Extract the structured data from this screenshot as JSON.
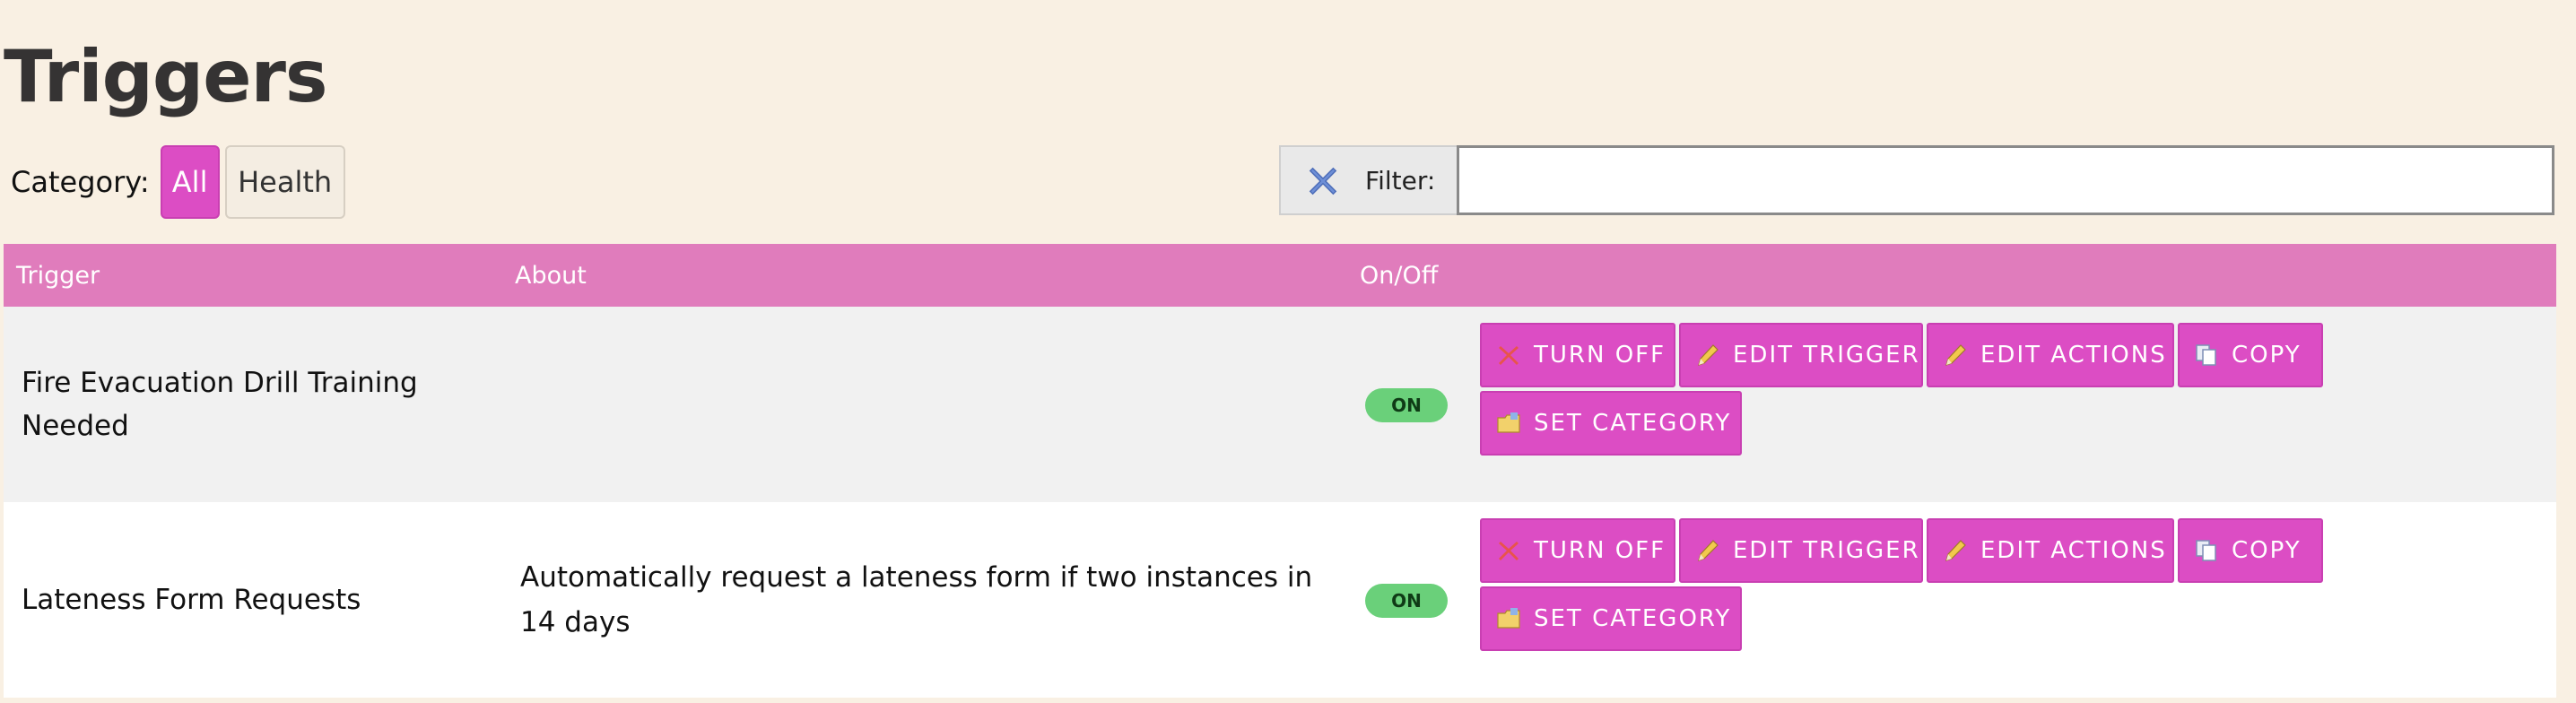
{
  "page": {
    "title": "Triggers"
  },
  "category": {
    "label": "Category:",
    "options": [
      {
        "label": "All",
        "active": true
      },
      {
        "label": "Health",
        "active": false
      }
    ]
  },
  "filter": {
    "label": "Filter:",
    "value": "",
    "clear_icon": "clear-filter-icon"
  },
  "table": {
    "headers": {
      "trigger": "Trigger",
      "about": "About",
      "onoff": "On/Off",
      "actions": ""
    },
    "rows": [
      {
        "trigger": "Fire Evacuation Drill Training Needed",
        "about": "",
        "status": "ON",
        "actions": {
          "turn_off": "TURN OFF",
          "edit_trigger": "EDIT TRIGGER",
          "edit_actions": "EDIT ACTIONS",
          "copy": "COPY",
          "set_category": "SET CATEGORY"
        }
      },
      {
        "trigger": "Lateness Form Requests",
        "about": "Automatically request a lateness form if two instances in 14 days",
        "status": "ON",
        "actions": {
          "turn_off": "TURN OFF",
          "edit_trigger": "EDIT TRIGGER",
          "edit_actions": "EDIT ACTIONS",
          "copy": "COPY",
          "set_category": "SET CATEGORY"
        }
      }
    ]
  },
  "colors": {
    "background": "#f9f0e3",
    "accent": "#dc4dc4",
    "header": "#e07cbc",
    "toggle_on": "#6ad07a"
  }
}
